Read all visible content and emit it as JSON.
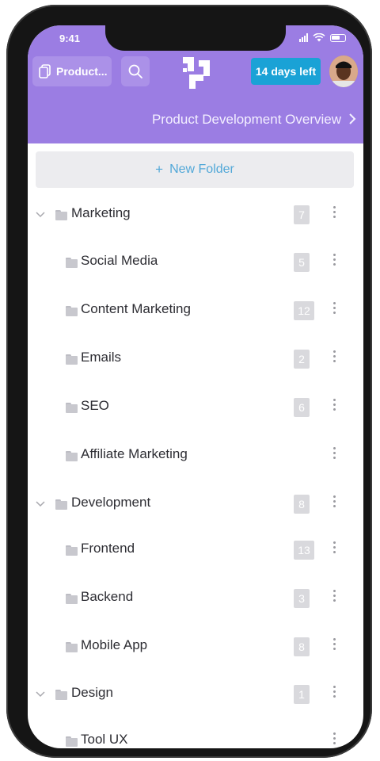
{
  "status_bar": {
    "time": "9:41"
  },
  "header": {
    "workspace_label": "Product...",
    "trial_label": "14 days left"
  },
  "breadcrumb": {
    "title": "Product Development Overview"
  },
  "new_folder": {
    "label": "New Folder"
  },
  "folders": [
    {
      "label": "Marketing",
      "count": "7",
      "level": 0
    },
    {
      "label": "Social Media",
      "count": "5",
      "level": 1
    },
    {
      "label": "Content Marketing",
      "count": "12",
      "level": 1
    },
    {
      "label": "Emails",
      "count": "2",
      "level": 1
    },
    {
      "label": "SEO",
      "count": "6",
      "level": 1
    },
    {
      "label": "Affiliate Marketing",
      "count": "",
      "level": 1
    },
    {
      "label": "Development",
      "count": "8",
      "level": 0
    },
    {
      "label": "Frontend",
      "count": "13",
      "level": 1
    },
    {
      "label": "Backend",
      "count": "3",
      "level": 1
    },
    {
      "label": "Mobile App",
      "count": "8",
      "level": 1
    },
    {
      "label": "Design",
      "count": "1",
      "level": 0
    },
    {
      "label": "Tool UX",
      "count": "",
      "level": 1
    }
  ],
  "colors": {
    "header_purple": "#9b7de3",
    "badge_blue": "#1aa2d6",
    "new_folder_text": "#52a8d8"
  }
}
